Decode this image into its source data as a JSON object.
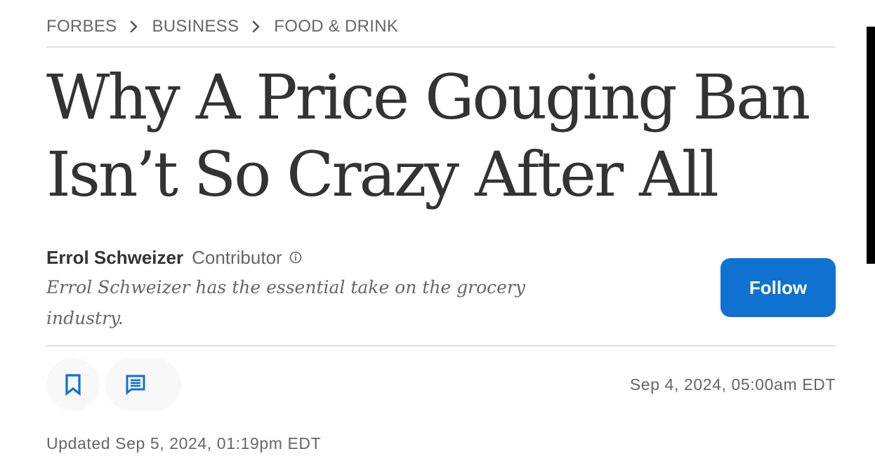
{
  "breadcrumb": {
    "items": [
      "FORBES",
      "BUSINESS",
      "FOOD & DRINK"
    ]
  },
  "article": {
    "title_line1": "Why A Price Gouging Ban",
    "title_line2": "Isn’t So Crazy After All",
    "author": {
      "name": "Errol Schweizer",
      "role": "Contributor",
      "bio": "Errol Schweizer has the essential take on the grocery industry."
    },
    "follow_label": "Follow",
    "published": "Sep 4, 2024, 05:00am EDT",
    "updated": "Updated Sep 5, 2024, 01:19pm EDT"
  },
  "icons": {
    "breadcrumb_separator": "chevron-right-icon",
    "contributor_info": "info-icon",
    "save": "bookmark-icon",
    "comments": "comment-icon"
  },
  "colors": {
    "accent": "#0f72d0",
    "text": "#333333",
    "muted": "#666666",
    "divider": "#e0e0e0",
    "action_bg": "#f8f8f8"
  }
}
